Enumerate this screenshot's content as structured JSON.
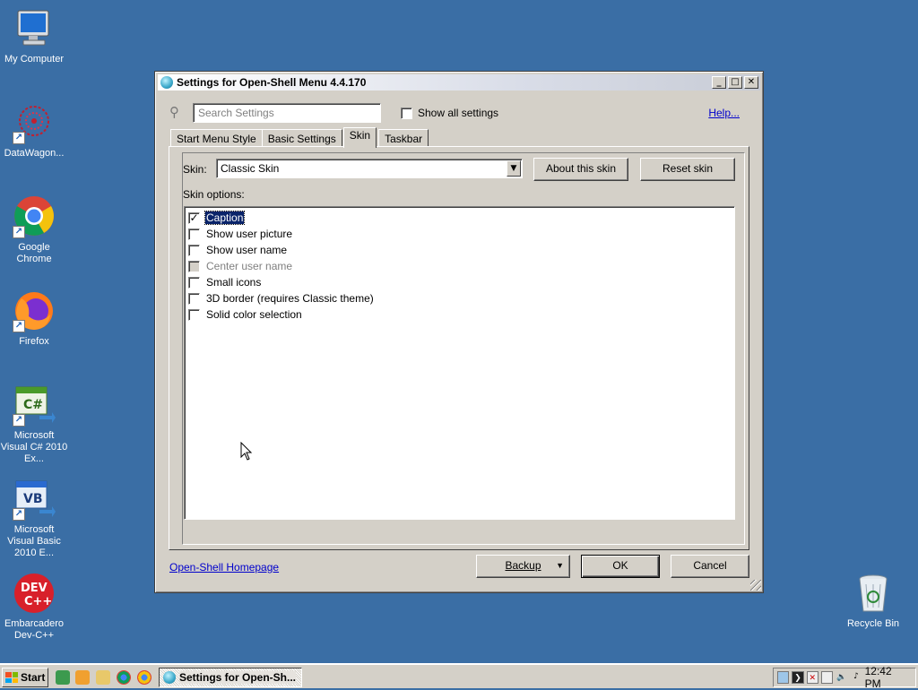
{
  "desktop": {
    "icons": [
      {
        "label": "My Computer"
      },
      {
        "label": "DataWagon..."
      },
      {
        "label": "Google Chrome"
      },
      {
        "label": "Firefox"
      },
      {
        "label": "Microsoft Visual C# 2010 Ex..."
      },
      {
        "label": "Microsoft Visual Basic 2010 E..."
      },
      {
        "label": "Embarcadero Dev-C++"
      },
      {
        "label": "Recycle Bin"
      }
    ],
    "background_color": "#3a6ea5"
  },
  "window": {
    "title": "Settings for Open-Shell Menu 4.4.170",
    "search_placeholder": "Search Settings",
    "show_all_label": "Show all settings",
    "show_all_checked": false,
    "help_label": "Help...",
    "tabs": [
      {
        "label": "Start Menu Style",
        "active": false
      },
      {
        "label": "Basic Settings",
        "active": false
      },
      {
        "label": "Skin",
        "active": true
      },
      {
        "label": "Taskbar",
        "active": false
      }
    ],
    "skin_label": "Skin:",
    "skin_value": "Classic Skin",
    "about_skin_label": "About this skin",
    "reset_skin_label": "Reset skin",
    "skin_options_label": "Skin options:",
    "skin_options": [
      {
        "label": "Caption",
        "checked": true,
        "disabled": false,
        "selected": true
      },
      {
        "label": "Show user picture",
        "checked": false,
        "disabled": false,
        "selected": false
      },
      {
        "label": "Show user name",
        "checked": false,
        "disabled": false,
        "selected": false
      },
      {
        "label": "Center user name",
        "checked": false,
        "disabled": true,
        "selected": false
      },
      {
        "label": "Small icons",
        "checked": false,
        "disabled": false,
        "selected": false
      },
      {
        "label": "3D border (requires Classic theme)",
        "checked": false,
        "disabled": false,
        "selected": false
      },
      {
        "label": "Solid color selection",
        "checked": false,
        "disabled": false,
        "selected": false
      }
    ],
    "homepage_label": "Open-Shell Homepage",
    "backup_label": "Backup",
    "ok_label": "OK",
    "cancel_label": "Cancel"
  },
  "taskbar": {
    "start_label": "Start",
    "task_label": "Settings for Open-Sh...",
    "clock": "12:42 PM"
  }
}
